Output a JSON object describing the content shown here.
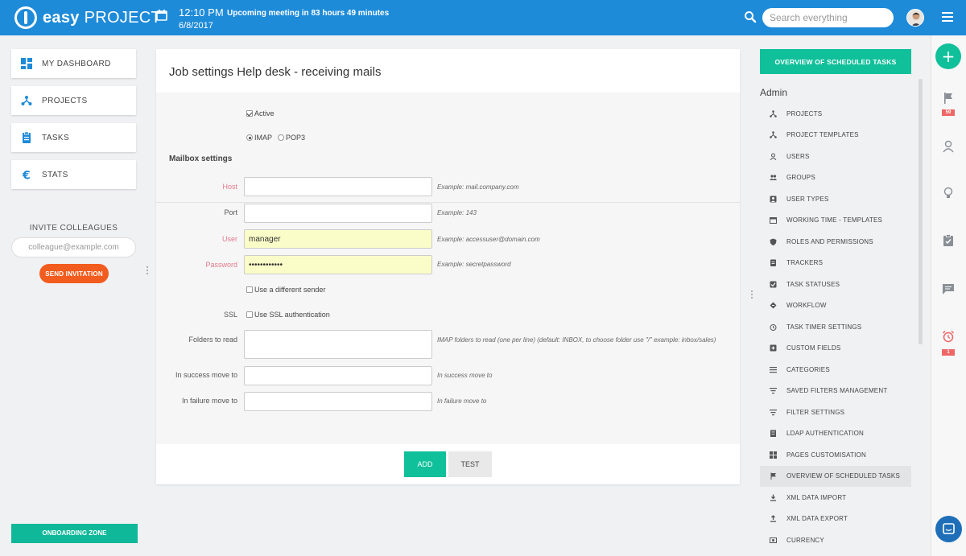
{
  "header": {
    "logo_bold": "easy",
    "logo_rest": "PROJECT",
    "time": "12:10 PM",
    "date": "6/8/2017",
    "meeting": "Upcoming meeting in 83 hours 49 minutes",
    "search_placeholder": "Search everything"
  },
  "left_nav": {
    "items": [
      {
        "label": "MY DASHBOARD",
        "icon": "dashboard-icon"
      },
      {
        "label": "PROJECTS",
        "icon": "projects-icon"
      },
      {
        "label": "TASKS",
        "icon": "tasks-icon"
      },
      {
        "label": "STATS",
        "icon": "euro-icon"
      }
    ],
    "invite_title": "INVITE COLLEAGUES",
    "invite_placeholder": "colleague@example.com",
    "send_label": "SEND INVITATION",
    "onboarding_label": "ONBOARDING ZONE"
  },
  "main": {
    "title": "Job settings Help desk - receiving mails",
    "active_label": "Active",
    "active_checked": true,
    "protocol_options": [
      "IMAP",
      "POP3"
    ],
    "protocol_selected": "IMAP",
    "section_title": "Mailbox settings",
    "host": {
      "label": "Host",
      "value": "",
      "hint": "Example: mail.company.com"
    },
    "port": {
      "label": "Port",
      "value": "",
      "hint": "Example: 143"
    },
    "user": {
      "label": "User",
      "value": "manager",
      "hint": "Example: accessuser@domain.com"
    },
    "password": {
      "label": "Password",
      "value": "••••••••••••",
      "hint": "Example: secretpassword"
    },
    "different_sender_label": "Use a different sender",
    "ssl_label": "SSL",
    "ssl_option_label": "Use SSL authentication",
    "folders": {
      "label": "Folders to read",
      "hint": "IMAP folders to read (one per line) (default: INBOX, to choose folder use \"/\" example: inbox/sales)"
    },
    "success": {
      "label": "In success move to",
      "hint": "In success move to"
    },
    "failure": {
      "label": "In failure move to",
      "hint": "In failure move to"
    },
    "add_label": "ADD",
    "test_label": "TEST"
  },
  "right_panel": {
    "overview_button": "OVERVIEW OF SCHEDULED TASKS",
    "admin_title": "Admin",
    "items": [
      {
        "label": "PROJECTS",
        "icon": "projects-icon"
      },
      {
        "label": "PROJECT TEMPLATES",
        "icon": "project-templates-icon"
      },
      {
        "label": "USERS",
        "icon": "user-icon"
      },
      {
        "label": "GROUPS",
        "icon": "groups-icon"
      },
      {
        "label": "USER TYPES",
        "icon": "user-types-icon"
      },
      {
        "label": "WORKING TIME - TEMPLATES",
        "icon": "calendar-icon"
      },
      {
        "label": "ROLES AND PERMISSIONS",
        "icon": "shield-icon"
      },
      {
        "label": "TRACKERS",
        "icon": "trackers-icon"
      },
      {
        "label": "TASK STATUSES",
        "icon": "task-status-icon"
      },
      {
        "label": "WORKFLOW",
        "icon": "workflow-icon"
      },
      {
        "label": "TASK TIMER SETTINGS",
        "icon": "timer-icon"
      },
      {
        "label": "CUSTOM FIELDS",
        "icon": "custom-fields-icon"
      },
      {
        "label": "CATEGORIES",
        "icon": "categories-icon"
      },
      {
        "label": "SAVED FILTERS MANAGEMENT",
        "icon": "filter-icon"
      },
      {
        "label": "FILTER SETTINGS",
        "icon": "filter-settings-icon"
      },
      {
        "label": "LDAP AUTHENTICATION",
        "icon": "ldap-icon"
      },
      {
        "label": "PAGES CUSTOMISATION",
        "icon": "pages-icon"
      },
      {
        "label": "OVERVIEW OF SCHEDULED TASKS",
        "icon": "flag-icon"
      },
      {
        "label": "XML DATA IMPORT",
        "icon": "import-icon"
      },
      {
        "label": "XML DATA EXPORT",
        "icon": "export-icon"
      },
      {
        "label": "CURRENCY",
        "icon": "currency-icon"
      }
    ],
    "active_index": 17
  },
  "rail": {
    "flag_badge": "59",
    "alarm_badge": "1"
  }
}
